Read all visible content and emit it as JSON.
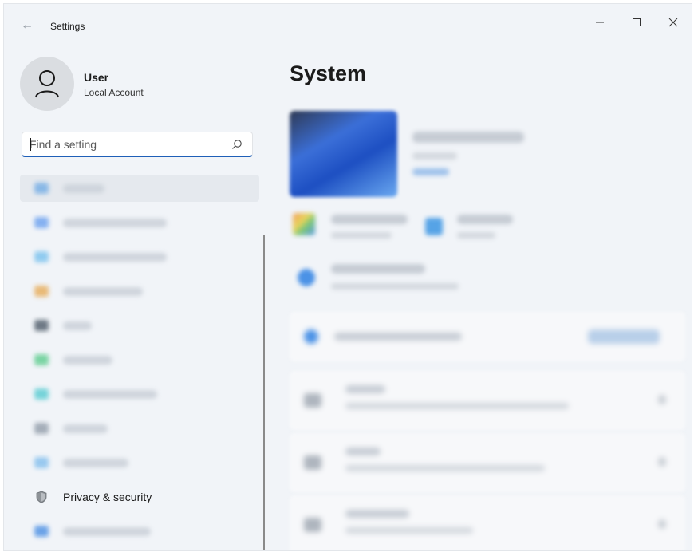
{
  "window": {
    "title": "Settings",
    "controls": {
      "minimize": "—",
      "maximize": "☐",
      "close": "✕"
    }
  },
  "user": {
    "name": "User",
    "account_type": "Local Account"
  },
  "search": {
    "placeholder": "Find a setting",
    "value": ""
  },
  "sidebar": {
    "items": [
      {
        "label": "",
        "blurred": true,
        "selected": true,
        "icon_color": "#7fb3e6"
      },
      {
        "label": "",
        "blurred": true,
        "icon_color": "#79a9f0"
      },
      {
        "label": "",
        "blurred": true,
        "icon_color": "#86c7ef"
      },
      {
        "label": "",
        "blurred": true,
        "icon_color": "#e8b46a"
      },
      {
        "label": "",
        "blurred": true,
        "icon_color": "#5f6b78"
      },
      {
        "label": "",
        "blurred": true,
        "icon_color": "#6ed19a"
      },
      {
        "label": "",
        "blurred": true,
        "icon_color": "#69d0d6"
      },
      {
        "label": "",
        "blurred": true,
        "icon_color": "#9ca6b2"
      },
      {
        "label": "",
        "blurred": true,
        "icon_color": "#8fc4ee"
      },
      {
        "label": "Privacy & security",
        "blurred": false,
        "icon": "shield-icon",
        "icon_color": "#7a7f86"
      },
      {
        "label": "",
        "blurred": true,
        "icon_color": "#5d9ae6"
      }
    ]
  },
  "main": {
    "title": "System"
  }
}
